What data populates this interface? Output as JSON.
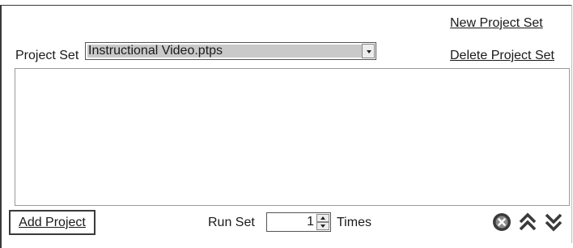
{
  "header": {
    "new_project_set_label": "New Project Set",
    "delete_project_set_label": "Delete Project Set"
  },
  "project_set": {
    "label": "Project Set",
    "selected_value": "Instructional Video.ptps"
  },
  "projects_list": {
    "items": []
  },
  "footer": {
    "add_project_label": "Add Project",
    "run_set_label": "Run Set",
    "run_count": "1",
    "times_label": "Times"
  },
  "icons": {
    "remove": "remove-icon",
    "move_up": "double-chevron-up-icon",
    "move_down": "double-chevron-down-icon"
  },
  "colors": {
    "icon_fill": "#3a3a3a",
    "select_highlight": "#c9c9c9"
  }
}
